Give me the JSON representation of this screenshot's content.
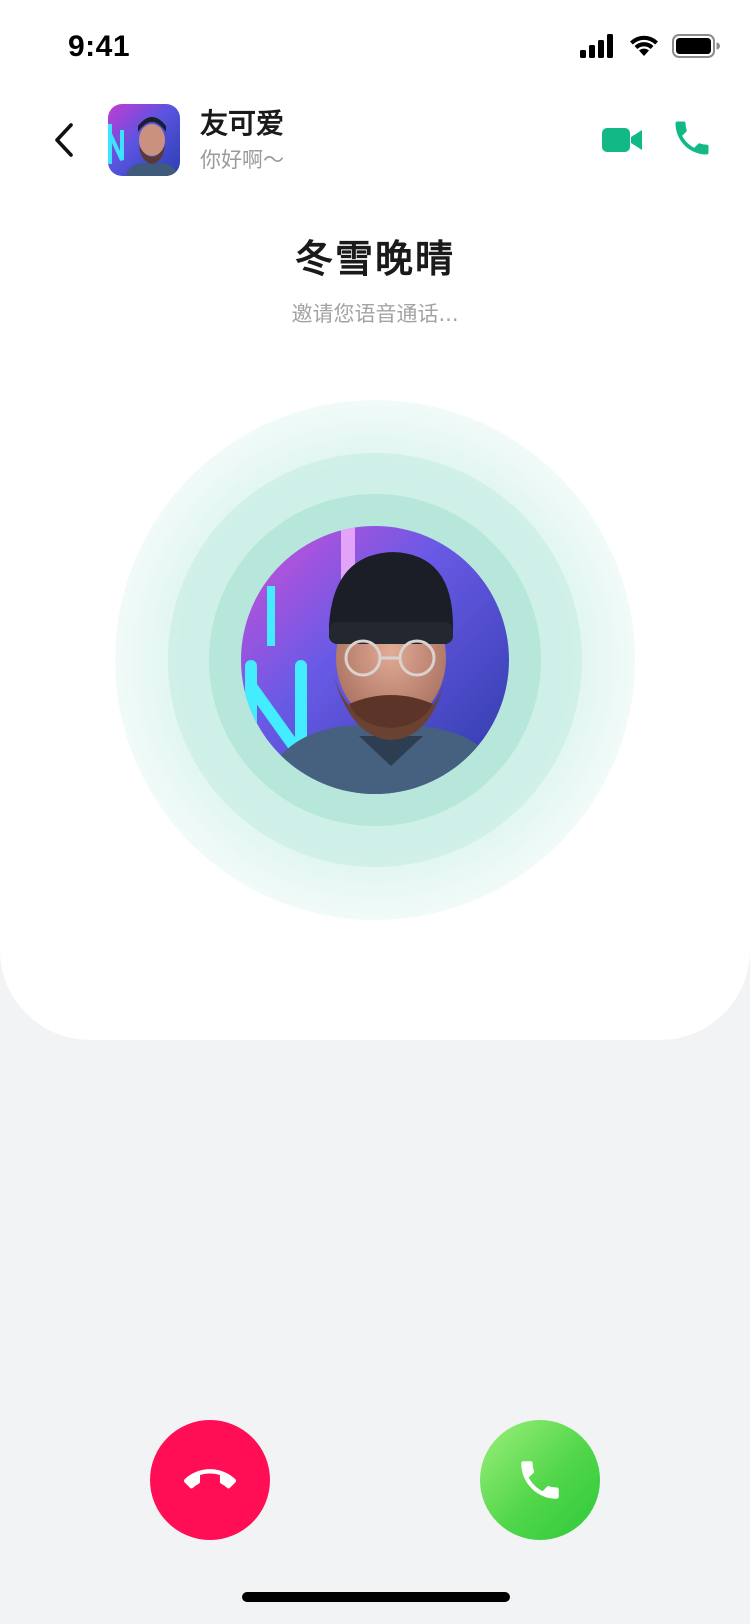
{
  "status_bar": {
    "time": "9:41",
    "icons": [
      "signal-icon",
      "wifi-icon",
      "battery-icon"
    ]
  },
  "header": {
    "back_icon": "chevron-left-icon",
    "contact_name": "友可爱",
    "contact_status": "你好啊～",
    "actions": [
      "video-camera-icon",
      "phone-icon"
    ]
  },
  "call": {
    "caller_name": "冬雪晚晴",
    "status_text": "邀请您语音通话..."
  },
  "buttons": {
    "decline_icon": "hang-up-icon",
    "accept_icon": "phone-icon"
  },
  "colors": {
    "accent": "#12b886",
    "decline": "#ff0d55",
    "accept": "#3ed04a",
    "background": "#f2f3f5"
  }
}
